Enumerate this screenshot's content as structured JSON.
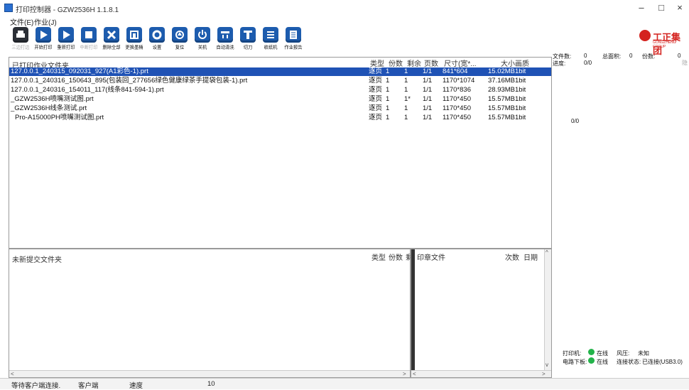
{
  "window": {
    "title": "打印控制器 - GZW2536H 1.1.8.1",
    "minimize": "–",
    "maximize": "□",
    "close": "×"
  },
  "menu": [
    "文件(E)",
    "作业(J)"
  ],
  "toolbar": [
    {
      "label": "三边打边",
      "icon": "printer-icon",
      "disabled": true
    },
    {
      "label": "开始打印",
      "icon": "play-icon"
    },
    {
      "label": "重新打印",
      "icon": "replay-icon"
    },
    {
      "label": "中断打印",
      "icon": "stop-icon",
      "disabled": true
    },
    {
      "label": "删除全部",
      "icon": "delete-icon"
    },
    {
      "label": "更换墨桶",
      "icon": "ink-icon"
    },
    {
      "label": "设置",
      "icon": "gear-icon"
    },
    {
      "label": "复位",
      "icon": "home-icon"
    },
    {
      "label": "关机",
      "icon": "power-icon"
    },
    {
      "label": "自动清洗",
      "icon": "clean-icon"
    },
    {
      "label": "切刀",
      "icon": "cutter-icon"
    },
    {
      "label": "收纸机",
      "icon": "winder-icon"
    },
    {
      "label": "作业报告",
      "icon": "report-icon"
    }
  ],
  "brand": {
    "name": "工正集团",
    "sub": "GONGZHENG GROUP"
  },
  "job_list": {
    "header": "已打印作业文件夹",
    "columns": [
      "类型",
      "份数",
      "剩余",
      "页数",
      "尺寸(宽*...",
      "大小",
      "画质"
    ],
    "rows": [
      {
        "name": "127.0.0.1_240315_092031_927(A1彩色-1).prt",
        "type": "逐页",
        "copies": "1",
        "remain": "1",
        "pages": "1/1",
        "size": "841*604",
        "file": "15.02MB",
        "quality": "1bit",
        "selected": true
      },
      {
        "name": "127.0.0.1_240316_150643_895(包装回_277656绿色健康绿茶手提袋包装-1).prt",
        "type": "逐页",
        "copies": "1",
        "remain": "1",
        "pages": "1/1",
        "size": "1170*1074",
        "file": "37.16MB",
        "quality": "1bit"
      },
      {
        "name": "127.0.0.1_240316_154011_117(线条841-594-1).prt",
        "type": "逐页",
        "copies": "1",
        "remain": "1",
        "pages": "1/1",
        "size": "1170*836",
        "file": "28.93MB",
        "quality": "1bit"
      },
      {
        "name": "_GZW2536H喷嘴测试图.prt",
        "type": "逐页",
        "copies": "1",
        "remain": "1*",
        "pages": "1/1",
        "size": "1170*450",
        "file": "15.57MB",
        "quality": "1bit"
      },
      {
        "name": "_GZW2536H线条测试.prt",
        "type": "逐页",
        "copies": "1",
        "remain": "1",
        "pages": "1/1",
        "size": "1170*450",
        "file": "15.57MB",
        "quality": "1bit"
      },
      {
        "name": "Pro-A15000PH喷嘴测试图.prt",
        "type": "逐页",
        "copies": "1",
        "remain": "1",
        "pages": "1/1",
        "size": "1170*450",
        "file": "15.57MB",
        "quality": "1bit"
      }
    ]
  },
  "new_files": {
    "header": "未新提交文件夹",
    "columns": [
      "类型",
      "份数",
      "剩"
    ]
  },
  "print_files": {
    "header": "印章文件",
    "columns": [
      "次数",
      "日期"
    ]
  },
  "stats": {
    "file_count_label": "文件数:",
    "file_count": "0",
    "total_label": "总面积:",
    "total": "0",
    "copies_label": "份数:",
    "copies": "0",
    "progress_label": "进度:",
    "progress": "0/0",
    "extra": "0/0",
    "hidden_tag": "隐"
  },
  "device": {
    "printer_label": "打印机:",
    "printer_status": "在线",
    "wind_label": "风压:",
    "wind": "未知",
    "board_label": "电路下板:",
    "board_status": "在线",
    "conn_label": "连接状态:",
    "conn": "已连接(USB3.0)"
  },
  "statusbar": {
    "msg": "等待客户端连接.",
    "client": "客户端",
    "speed": "速度",
    "value": "10"
  }
}
